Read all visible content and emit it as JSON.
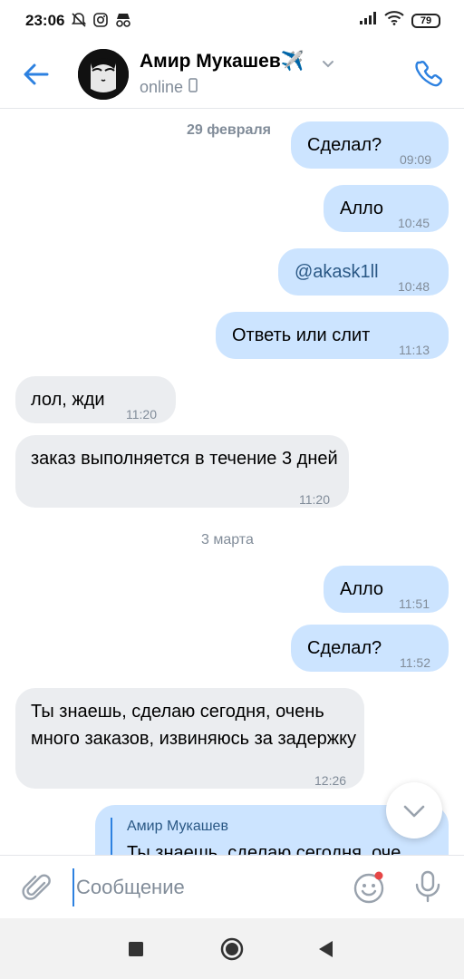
{
  "status_bar": {
    "time": "23:06",
    "battery": "79"
  },
  "header": {
    "contact_name": "Амир Мукашев",
    "contact_emoji": "✈️",
    "status": "online"
  },
  "chat": {
    "messages": [
      {
        "type": "date",
        "text": "29 февраля"
      },
      {
        "type": "out",
        "text": "Сделал?",
        "time": "09:09"
      },
      {
        "type": "out",
        "text": "Алло",
        "time": "10:45"
      },
      {
        "type": "out",
        "text": "@akask1ll",
        "time": "10:48"
      },
      {
        "type": "out",
        "text": "Ответь или слит",
        "time": "11:13"
      },
      {
        "type": "in",
        "text": "лол, жди",
        "time": "11:20"
      },
      {
        "type": "in",
        "text": "заказ выполняется в течение 3 дней",
        "time": "11:20"
      },
      {
        "type": "date",
        "text": "3 марта"
      },
      {
        "type": "out",
        "text": "Алло",
        "time": "11:51"
      },
      {
        "type": "out",
        "text": "Сделал?",
        "time": "11:52"
      },
      {
        "type": "in",
        "text": "Ты знаешь, сделаю сегодня, очень много заказов, извиняюсь за задержку",
        "time": "12:26"
      },
      {
        "type": "reply",
        "author": "Амир Мукашев",
        "quote": "Ты знаешь, сделаю сегодня, оче"
      }
    ]
  },
  "composer": {
    "placeholder": "Сообщение"
  },
  "colors": {
    "accent": "#2d81e0",
    "outgoing_bubble": "#cce4ff",
    "incoming_bubble": "#ebedf0",
    "secondary_text": "#818c99"
  }
}
